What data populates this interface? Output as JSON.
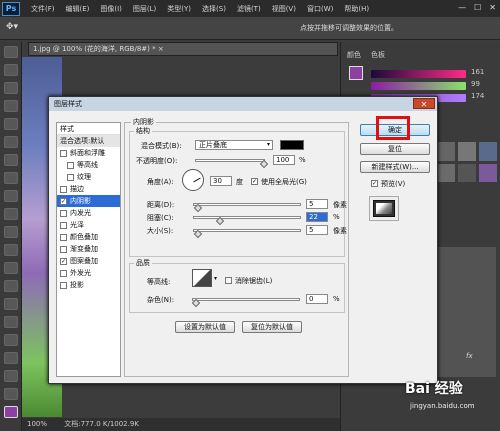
{
  "app": {
    "logo": "Ps"
  },
  "menu": [
    "文件(F)",
    "编辑(E)",
    "图像(I)",
    "图层(L)",
    "类型(Y)",
    "选择(S)",
    "滤镜(T)",
    "视图(V)",
    "窗口(W)",
    "帮助(H)"
  ],
  "window_controls": [
    "—",
    "☐",
    "✕"
  ],
  "options_bar": {
    "hint": "点按并拖移可调整效果的位置。"
  },
  "document_tab": {
    "title": "1.jpg @ 100% (花的海洋, RGB/8#) * ×"
  },
  "status": {
    "zoom": "100%",
    "doc": "文档:777.0 K/1002.9K"
  },
  "right_panel": {
    "tabs": [
      "颜色",
      "色板"
    ],
    "values": [
      "161",
      "99",
      "174"
    ],
    "fx": "fx"
  },
  "watermark": {
    "text": "Bai 经验",
    "url": "jingyan.baidu.com"
  },
  "dialog": {
    "title": "图层样式",
    "close": "✕",
    "styles_header": "样式",
    "blend_options": "混合选项:默认",
    "styles": [
      {
        "label": "斜面和浮雕",
        "checked": false,
        "indent": false
      },
      {
        "label": "等高线",
        "checked": false,
        "indent": true
      },
      {
        "label": "纹理",
        "checked": false,
        "indent": true
      },
      {
        "label": "描边",
        "checked": false,
        "indent": false
      },
      {
        "label": "内阴影",
        "checked": true,
        "indent": false,
        "active": true
      },
      {
        "label": "内发光",
        "checked": false,
        "indent": false
      },
      {
        "label": "光泽",
        "checked": false,
        "indent": false
      },
      {
        "label": "颜色叠加",
        "checked": false,
        "indent": false
      },
      {
        "label": "渐变叠加",
        "checked": false,
        "indent": false
      },
      {
        "label": "图案叠加",
        "checked": true,
        "indent": false
      },
      {
        "label": "外发光",
        "checked": false,
        "indent": false
      },
      {
        "label": "投影",
        "checked": false,
        "indent": false
      }
    ],
    "section": "内阴影",
    "structure": {
      "label": "结构",
      "blend_mode_label": "混合模式(B):",
      "blend_mode": "正片叠底",
      "opacity_label": "不透明度(O):",
      "opacity": "100",
      "opacity_unit": "%",
      "angle_label": "角度(A):",
      "angle": "30",
      "angle_unit": "度",
      "global_light": "使用全局光(G)",
      "distance_label": "距离(D):",
      "distance": "5",
      "distance_unit": "像素",
      "choke_label": "阻塞(C):",
      "choke": "22",
      "choke_unit": "%",
      "size_label": "大小(S):",
      "size": "5",
      "size_unit": "像素"
    },
    "quality": {
      "label": "品质",
      "contour_label": "等高线:",
      "anti_alias": "消除锯齿(L)",
      "noise_label": "杂色(N):",
      "noise": "0",
      "noise_unit": "%"
    },
    "buttons": {
      "make_default": "设置为默认值",
      "reset_default": "复位为默认值",
      "ok": "确定",
      "reset": "复位",
      "new_style": "新建样式(W)...",
      "preview": "预览(V)"
    },
    "colors": {
      "shadow": "#000000",
      "highlight": "#e01010"
    }
  }
}
